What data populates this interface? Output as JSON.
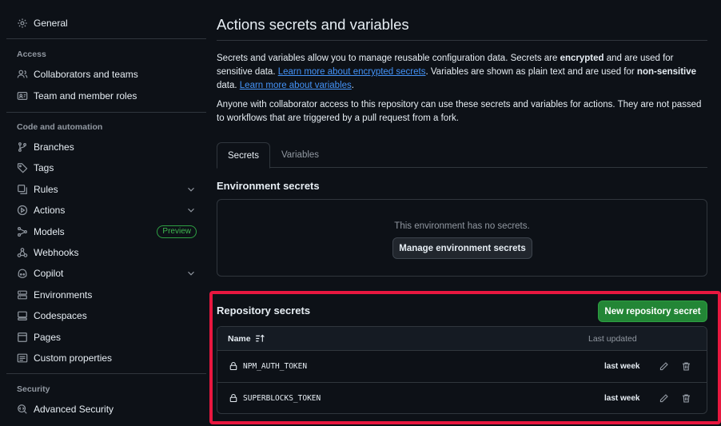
{
  "sidebar": {
    "general": "General",
    "sections": {
      "access": "Access",
      "code_automation": "Code and automation",
      "security": "Security"
    },
    "items": {
      "collaborators": "Collaborators and teams",
      "team_roles": "Team and member roles",
      "branches": "Branches",
      "tags": "Tags",
      "rules": "Rules",
      "actions": "Actions",
      "models": "Models",
      "models_badge": "Preview",
      "webhooks": "Webhooks",
      "copilot": "Copilot",
      "environments": "Environments",
      "codespaces": "Codespaces",
      "pages": "Pages",
      "custom_properties": "Custom properties",
      "advanced_security": "Advanced Security"
    }
  },
  "main": {
    "title": "Actions secrets and variables",
    "intro": {
      "t1": "Secrets and variables allow you to manage reusable configuration data. Secrets are ",
      "b1": "encrypted",
      "t2": " and are used for sensitive data. ",
      "link1": "Learn more about encrypted secrets",
      "t3": ". Variables are shown as plain text and are used for ",
      "b2": "non-sensitive",
      "t4": " data. ",
      "link2": "Learn more about variables",
      "t5": "."
    },
    "access_note": "Anyone with collaborator access to this repository can use these secrets and variables for actions. They are not passed to workflows that are triggered by a pull request from a fork.",
    "tabs": [
      "Secrets",
      "Variables"
    ],
    "env_secrets": {
      "heading": "Environment secrets",
      "empty": "This environment has no secrets.",
      "manage_button": "Manage environment secrets"
    },
    "repo_secrets": {
      "heading": "Repository secrets",
      "new_button": "New repository secret",
      "col_name": "Name",
      "col_updated": "Last updated",
      "rows": [
        {
          "name": "NPM_AUTH_TOKEN",
          "updated": "last week"
        },
        {
          "name": "SUPERBLOCKS_TOKEN",
          "updated": "last week"
        }
      ]
    }
  },
  "colors": {
    "background": "#0d1117",
    "border": "#30363d",
    "link": "#4493f8",
    "primary_button": "#238636",
    "highlight": "#e8173f"
  }
}
